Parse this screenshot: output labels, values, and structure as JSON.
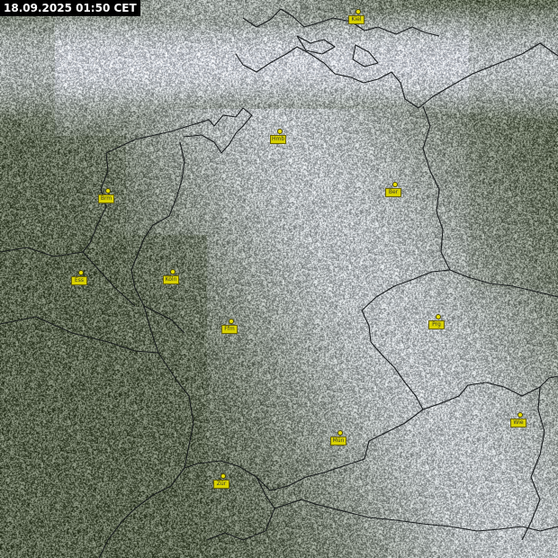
{
  "timestamp": "18.09.2025 01:50 CET",
  "colors": {
    "land": "#5b6550",
    "cloud": "#c8ccd3",
    "sea_cloud": "#d9dce2",
    "border": "#1a1d1f",
    "marker": "#e8e000",
    "timestamp_bg": "#000000",
    "timestamp_text": "#ffffff"
  },
  "cities": [
    {
      "id": "hamburg",
      "label": "Hmb"
    },
    {
      "id": "kiel",
      "label": "Kiel"
    },
    {
      "id": "berlin",
      "label": "Ber"
    },
    {
      "id": "bremen",
      "label": "Brm"
    },
    {
      "id": "essen",
      "label": "Ess"
    },
    {
      "id": "cologne",
      "label": "Köln"
    },
    {
      "id": "frankfurt",
      "label": "Ffm"
    },
    {
      "id": "prague",
      "label": "Prg"
    },
    {
      "id": "munich",
      "label": "Mün"
    },
    {
      "id": "zurich",
      "label": "Zür"
    },
    {
      "id": "vienna",
      "label": "Wie"
    }
  ]
}
